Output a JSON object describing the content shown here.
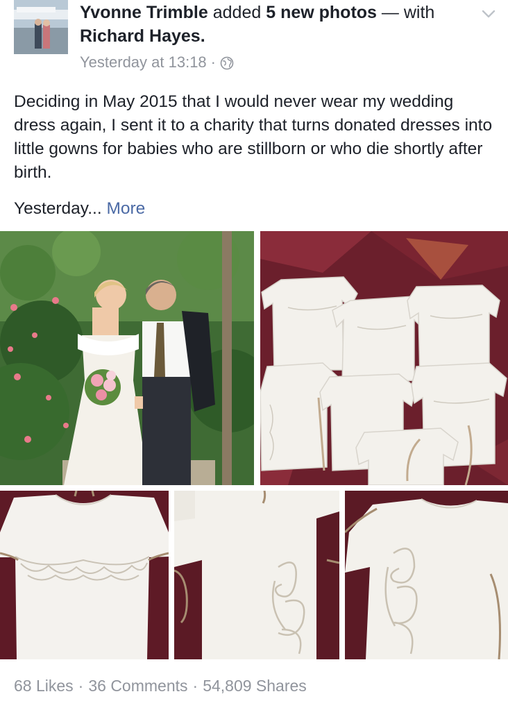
{
  "post": {
    "author": "Yvonne Trimble",
    "action": "added",
    "photo_count_text": "5 new photos",
    "with_text": "— with",
    "tagged": "Richard Hayes.",
    "timestamp": "Yesterday at 13:18",
    "meta_separator": "·",
    "privacy_icon": "globe-icon",
    "body": "Deciding in May 2015 that I would never wear my wedding dress again, I sent it to a charity that turns donated dresses into little gowns for babies who are stillborn or who die shortly after birth.",
    "truncated_text": "Yesterday...",
    "more_label": "More"
  },
  "photos": [
    {
      "subject": "wedding-couple"
    },
    {
      "subject": "gowns-collection"
    },
    {
      "subject": "gown-front-lace"
    },
    {
      "subject": "gown-side-lace"
    },
    {
      "subject": "gown-angle-lace"
    }
  ],
  "footer": {
    "likes": "68 Likes",
    "comments": "36 Comments",
    "shares": "54,809 Shares",
    "separator": "·"
  },
  "colors": {
    "text": "#1d2129",
    "meta": "#90949c",
    "link": "#4b6aa5"
  }
}
